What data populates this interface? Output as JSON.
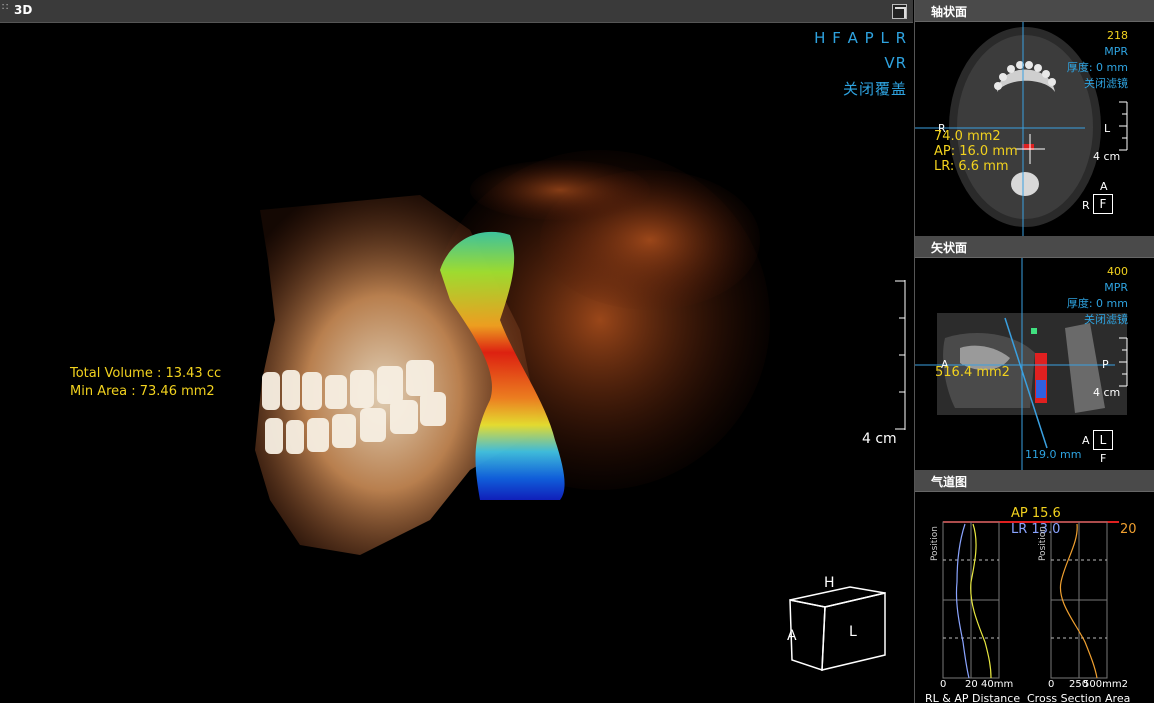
{
  "main": {
    "title": "3D",
    "orientation": "H F A P L R",
    "render_mode": "VR",
    "overlay_toggle": "关闭覆盖",
    "measure": {
      "volume": "Total Volume : 13.43 cc",
      "min_area": "Min Area : 73.46 mm2"
    },
    "scale_label": "4 cm",
    "cube": {
      "top": "H",
      "left": "A",
      "front": "L"
    }
  },
  "axial": {
    "title": "轴状面",
    "slice": "218",
    "mode": "MPR",
    "thickness": "厚度: 0 mm",
    "filter": "关闭滤镜",
    "area": "74.0 mm2",
    "ap": "AP: 16.0 mm",
    "lr": "LR: 6.6 mm",
    "left_marker": "R",
    "right_marker": "L",
    "scale": "4 cm",
    "bottom_marker": "A",
    "box_left": "R",
    "box": "F"
  },
  "sagittal": {
    "title": "矢状面",
    "slice": "400",
    "mode": "MPR",
    "thickness": "厚度: 0 mm",
    "filter": "关闭滤镜",
    "area": "516.4 mm2",
    "left_marker": "A",
    "right_marker": "P",
    "scale": "4 cm",
    "length": "119.0 mm",
    "box_left": "A",
    "box": "L",
    "bottom_marker": "F"
  },
  "airway": {
    "title": "气道图",
    "ap_label": "AP 15.6",
    "lr_label": "LR 13.0",
    "right_value": "20",
    "position_label": "Position",
    "chart1_ticks": [
      "0",
      "20",
      "40mm"
    ],
    "chart2_ticks": [
      "0",
      "250",
      "500mm2"
    ],
    "footer1": "RL & AP Distance",
    "footer2": "Cross Section Area",
    "colors": {
      "ap": "#e8e840",
      "lr": "#8aa4ff",
      "area": "#f0a030",
      "top_line": "#e02020"
    }
  }
}
